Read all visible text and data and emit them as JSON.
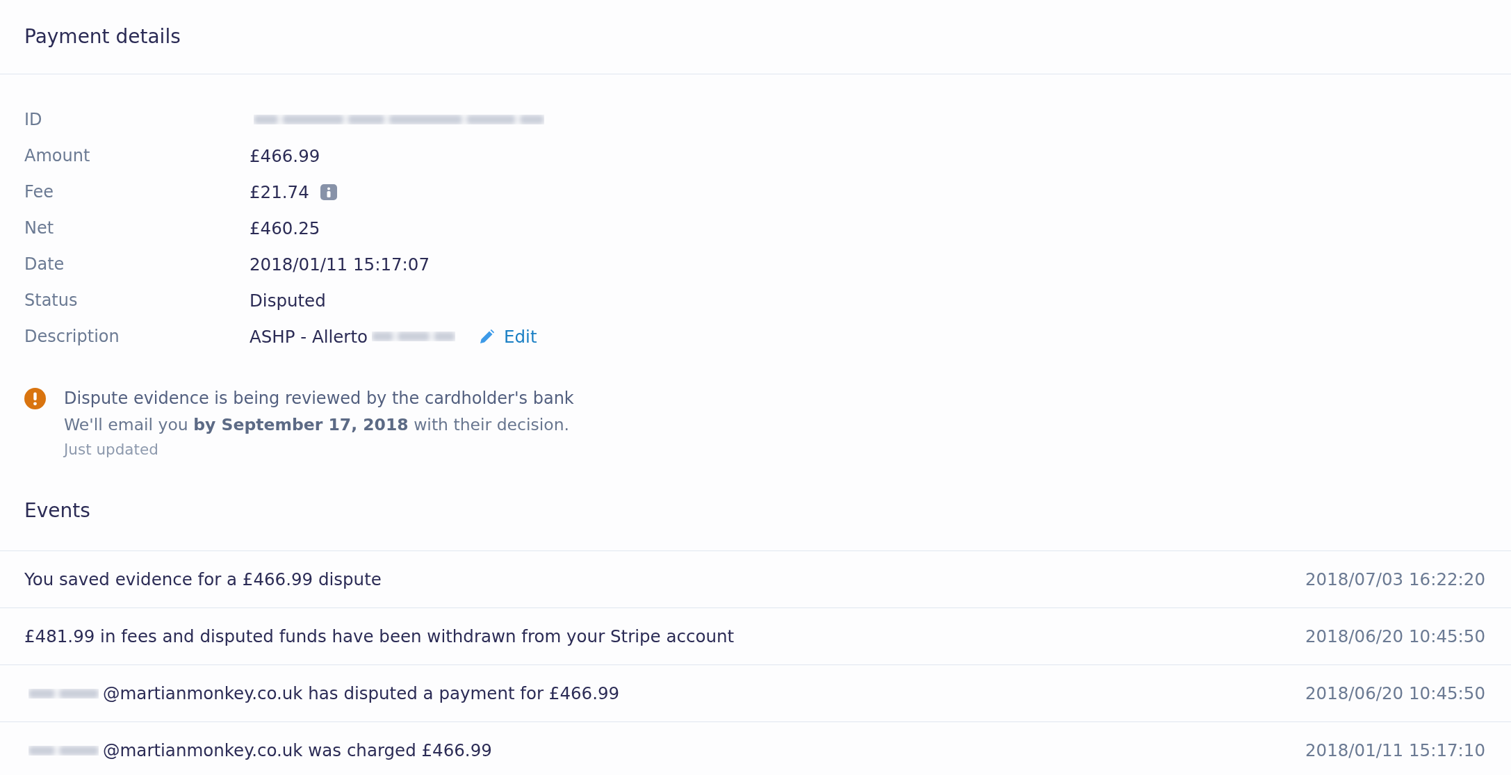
{
  "header": {
    "title": "Payment details"
  },
  "details": [
    {
      "label": "ID",
      "value_blurred": true
    },
    {
      "label": "Amount",
      "value": "£466.99"
    },
    {
      "label": "Fee",
      "value": "£21.74",
      "info": true
    },
    {
      "label": "Net",
      "value": "£460.25"
    },
    {
      "label": "Date",
      "value": "2018/01/11 15:17:07"
    },
    {
      "label": "Status",
      "value": "Disputed"
    },
    {
      "label": "Description",
      "value": "ASHP - Allerto",
      "value_blurred": true,
      "action": "Edit"
    }
  ],
  "notice": {
    "title": "Dispute evidence is being reviewed by the cardholder's bank",
    "message": "We'll email you **by September 17, 2018** with their decision.",
    "updated": "Just updated"
  },
  "events": {
    "title": "Events",
    "rows": [
      {
        "text": "You saved evidence for a £466.99 dispute",
        "time": "2018/07/03 16:22:20"
      },
      {
        "text": "£481.99 in fees and disputed funds have been withdrawn from your Stripe account",
        "time": "2018/06/20 10:45:50"
      },
      {
        "text": "@martianmonkey.co.uk has disputed a payment for £466.99",
        "sender_blurred": true,
        "time": "2018/06/20 10:45:50"
      },
      {
        "text": "@martianmonkey.co.uk was charged £466.99",
        "sender_blurred": true,
        "time": "2018/01/11 15:17:10"
      }
    ]
  }
}
